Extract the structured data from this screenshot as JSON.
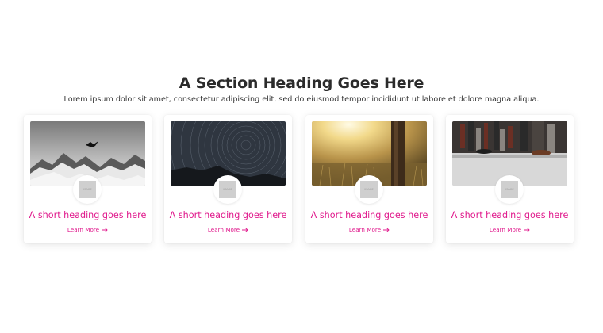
{
  "section": {
    "heading": "A Section Heading Goes Here",
    "subtext": "Lorem ipsum dolor sit amet, consectetur adipiscing elit, sed do eiusmod tempor incididunt ut labore et dolore magna aliqua."
  },
  "cards": [
    {
      "title": "A short heading goes here",
      "link_label": "Learn More",
      "image": "snowy-mountain-bird-photo",
      "avatar_text": "IMAGE"
    },
    {
      "title": "A short heading goes here",
      "link_label": "Learn More",
      "image": "star-trails-night-photo",
      "avatar_text": "IMAGE"
    },
    {
      "title": "A short heading goes here",
      "link_label": "Learn More",
      "image": "sunlit-field-tree-photo",
      "avatar_text": "IMAGE"
    },
    {
      "title": "A short heading goes here",
      "link_label": "Learn More",
      "image": "commuters-feet-photo",
      "avatar_text": "IMAGE"
    }
  ],
  "colors": {
    "accent": "#e0198c",
    "heading": "#2b2b2b",
    "body_text": "#333333",
    "card_background": "#ffffff",
    "avatar_placeholder": "#cfcfcf"
  }
}
